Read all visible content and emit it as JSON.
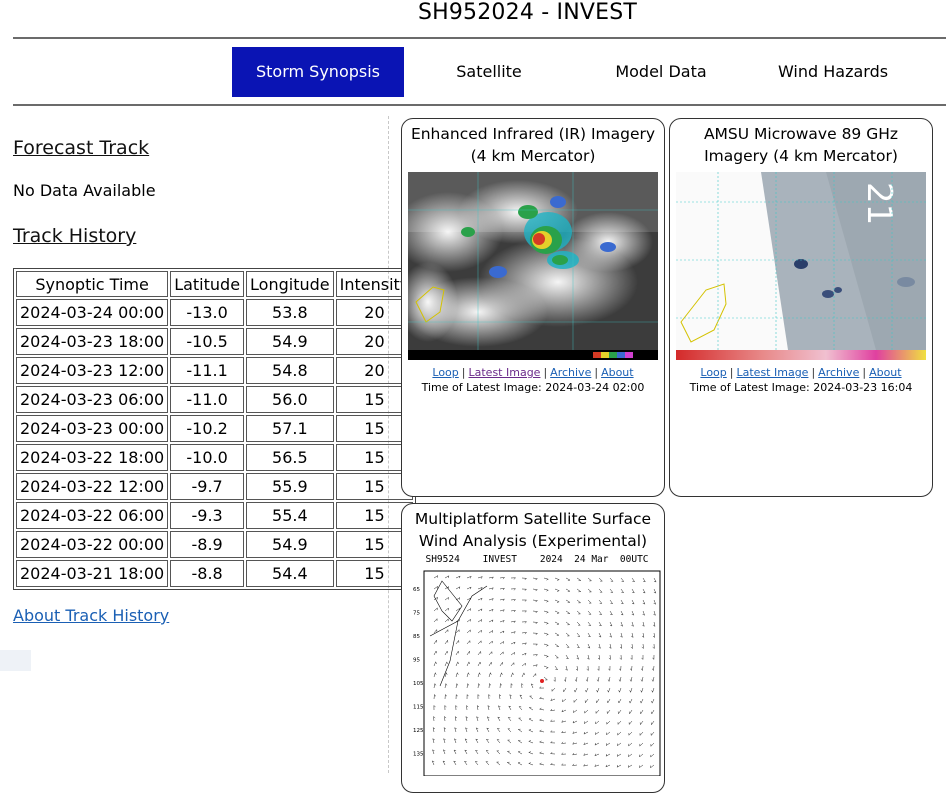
{
  "page": {
    "title": "SH952024 - INVEST"
  },
  "nav": {
    "items": [
      {
        "label": "Storm Synopsis",
        "active": true
      },
      {
        "label": "Satellite",
        "active": false
      },
      {
        "label": "Model Data",
        "active": false
      },
      {
        "label": "Wind Hazards",
        "active": false
      }
    ],
    "active_color": "#0a14b4"
  },
  "left": {
    "forecast_heading": "Forecast Track",
    "forecast_text": "No Data Available",
    "history_heading": "Track History",
    "table": {
      "columns": [
        "Synoptic Time",
        "Latitude",
        "Longitude",
        "Intensity"
      ],
      "rows": [
        [
          "2024-03-24 00:00",
          "-13.0",
          "53.8",
          "20"
        ],
        [
          "2024-03-23 18:00",
          "-10.5",
          "54.9",
          "20"
        ],
        [
          "2024-03-23 12:00",
          "-11.1",
          "54.8",
          "20"
        ],
        [
          "2024-03-23 06:00",
          "-11.0",
          "56.0",
          "15"
        ],
        [
          "2024-03-23 00:00",
          "-10.2",
          "57.1",
          "15"
        ],
        [
          "2024-03-22 18:00",
          "-10.0",
          "56.5",
          "15"
        ],
        [
          "2024-03-22 12:00",
          "-9.7",
          "55.9",
          "15"
        ],
        [
          "2024-03-22 06:00",
          "-9.3",
          "55.4",
          "15"
        ],
        [
          "2024-03-22 00:00",
          "-8.9",
          "54.9",
          "15"
        ],
        [
          "2024-03-21 18:00",
          "-8.8",
          "54.4",
          "15"
        ]
      ]
    },
    "about_link": "About Track History"
  },
  "cards": {
    "ir": {
      "title": "Enhanced Infrared (IR) Imagery (4 km Mercator)",
      "links": [
        "Loop",
        "Latest Image",
        "Archive",
        "About"
      ],
      "time": "Time of Latest Image: 2024-03-24 02:00"
    },
    "amsu": {
      "title": "AMSU Microwave 89 GHz Imagery (4 km Mercator)",
      "links": [
        "Loop",
        "Latest Image",
        "Archive",
        "About"
      ],
      "time": "Time of Latest Image: 2024-03-23 16:04"
    },
    "wind": {
      "title": "Multiplatform Satellite Surface Wind Analysis (Experimental)",
      "image_header": "SH9524    INVEST    2024  24 Mar  00UTC",
      "y_ticks": [
        "65",
        "75",
        "85",
        "95",
        "105",
        "115",
        "125",
        "135"
      ]
    }
  }
}
